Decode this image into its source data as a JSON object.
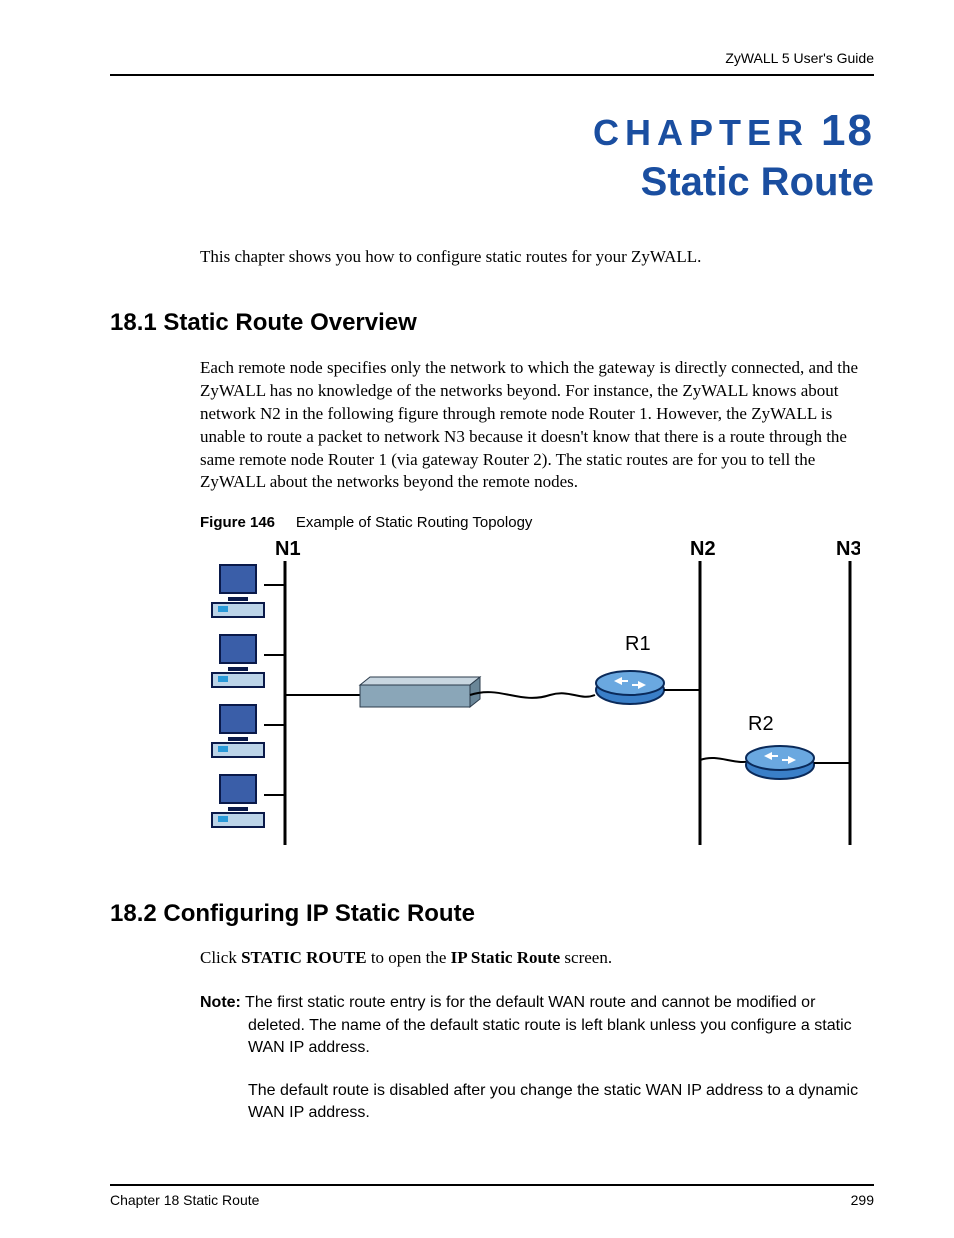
{
  "header": {
    "guide": "ZyWALL 5 User's Guide"
  },
  "chapter": {
    "label": "CHAPTER",
    "number": "18",
    "title": "Static Route"
  },
  "intro": "This chapter shows you how to configure static routes for your ZyWALL.",
  "section1": {
    "heading": "18.1  Static Route Overview",
    "body": "Each remote node specifies only the network to which the gateway is directly connected, and the ZyWALL has no knowledge of the networks beyond. For instance, the ZyWALL knows about network N2 in the following figure through remote node Router 1. However, the ZyWALL is unable to route a packet to network N3 because it doesn't know that there is a route through the same remote node Router 1 (via gateway Router 2). The static routes are for you to tell the ZyWALL about the networks beyond the remote nodes."
  },
  "figure": {
    "label": "Figure 146",
    "caption": "Example of Static Routing Topology",
    "labels": {
      "n1": "N1",
      "n2": "N2",
      "n3": "N3",
      "r1": "R1",
      "r2": "R2"
    }
  },
  "section2": {
    "heading": "18.2  Configuring IP Static Route",
    "click_pre": "Click ",
    "click_bold1": "STATIC ROUTE",
    "click_mid": " to open the ",
    "click_bold2": "IP Static Route",
    "click_post": " screen.",
    "note_label": "Note:",
    "note1": " The first static route entry is for the default WAN route and cannot be modified or deleted. The name of the default static route is left blank unless you configure a static WAN IP address.",
    "note2": "The default route is disabled after you change the static WAN IP address to a dynamic WAN IP address."
  },
  "footer": {
    "left": "Chapter 18 Static Route",
    "right": "299"
  }
}
